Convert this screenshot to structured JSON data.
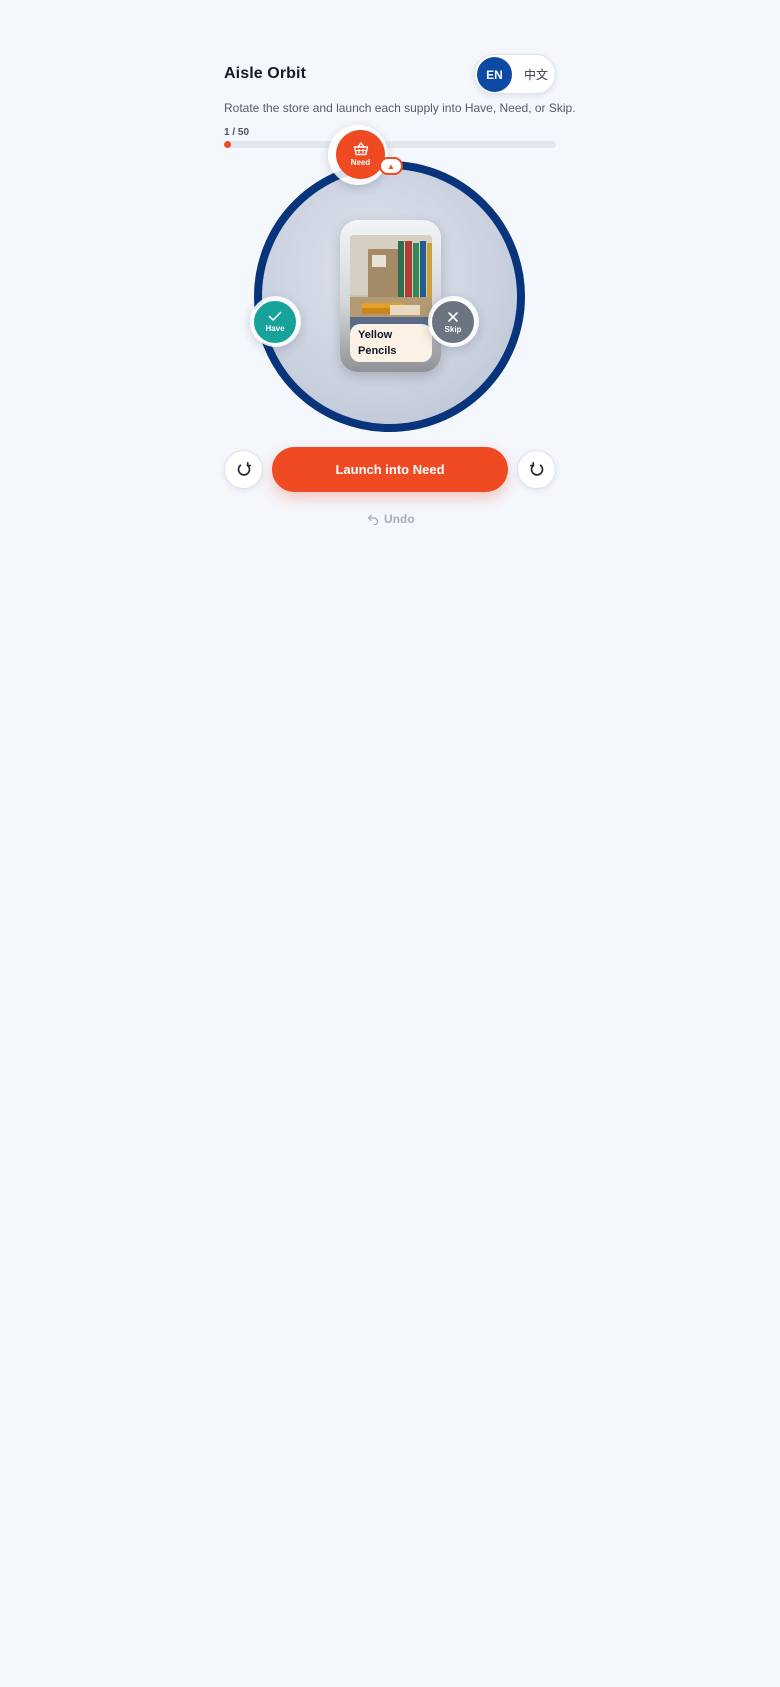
{
  "header": {
    "title": "Aisle Orbit",
    "lang_en": "EN",
    "lang_zh": "中文"
  },
  "subtitle": "Rotate the store and launch each supply into Have, Need, or Skip.",
  "progress": {
    "label": "1 / 50",
    "current": 1,
    "total": 50
  },
  "orbit": {
    "need": {
      "label": "Need",
      "icon": "basket-icon",
      "color": "#f04a23"
    },
    "have": {
      "label": "Have",
      "icon": "check-icon",
      "color": "#16a39c"
    },
    "skip": {
      "label": "Skip",
      "icon": "close-icon",
      "color": "#6c7482"
    },
    "pointer_glyph": "▲",
    "ring_color": "#08347c"
  },
  "card": {
    "item_name": "Yellow Pencils"
  },
  "controls": {
    "launch_label": "Launch into Need",
    "undo_label": "Undo"
  }
}
